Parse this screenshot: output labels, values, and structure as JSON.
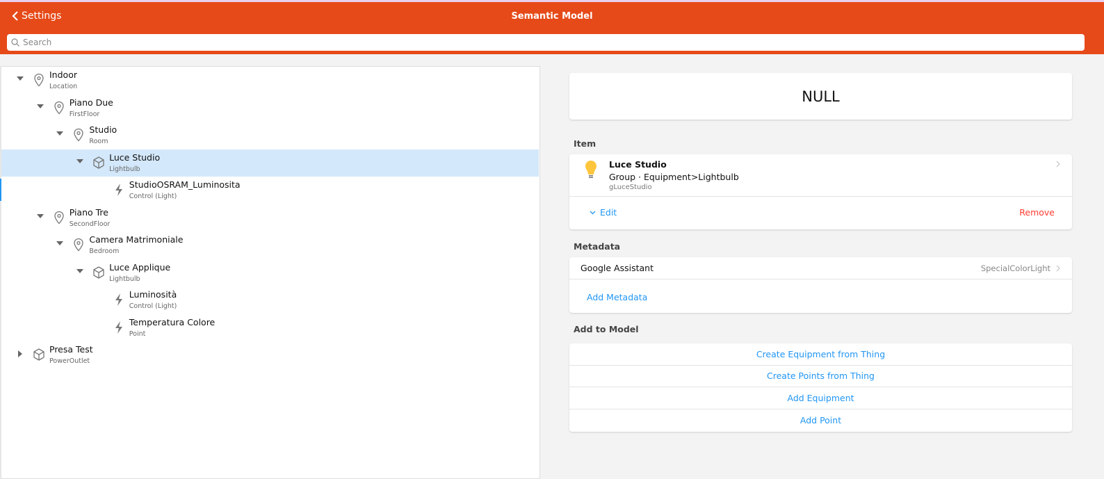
{
  "navbar": {
    "back_label": "Settings",
    "title": "Semantic Model",
    "search_placeholder": "Search"
  },
  "tree": [
    {
      "label": "Indoor",
      "sub": "Location",
      "level": 0,
      "icon": "location",
      "caret": "down"
    },
    {
      "label": "Piano Due",
      "sub": "FirstFloor",
      "level": 1,
      "icon": "location",
      "caret": "down"
    },
    {
      "label": "Studio",
      "sub": "Room",
      "level": 2,
      "icon": "location",
      "caret": "down"
    },
    {
      "label": "Luce Studio",
      "sub": "Lightbulb",
      "level": 3,
      "icon": "cube",
      "caret": "down",
      "selected": true
    },
    {
      "label": "StudioOSRAM_Luminosita",
      "sub": "Control (Light)",
      "level": 4,
      "icon": "bolt",
      "caret": ""
    },
    {
      "label": "Piano Tre",
      "sub": "SecondFloor",
      "level": 1,
      "icon": "location",
      "caret": "down"
    },
    {
      "label": "Camera Matrimoniale",
      "sub": "Bedroom",
      "level": 2,
      "icon": "location",
      "caret": "down"
    },
    {
      "label": "Luce Applique",
      "sub": "Lightbulb",
      "level": 3,
      "icon": "cube",
      "caret": "down"
    },
    {
      "label": "Luminosità",
      "sub": "Control (Light)",
      "level": 4,
      "icon": "bolt",
      "caret": ""
    },
    {
      "label": "Temperatura Colore",
      "sub": "Point",
      "level": 4,
      "icon": "bolt",
      "caret": ""
    },
    {
      "label": "Presa Test",
      "sub": "PowerOutlet",
      "level": 0,
      "icon": "cube",
      "caret": "right"
    }
  ],
  "state": {
    "value": "NULL"
  },
  "item": {
    "section": "Item",
    "name": "Luce Studio",
    "type": "Group · Equipment>Lightbulb",
    "id": "gLuceStudio",
    "edit": "Edit",
    "remove": "Remove"
  },
  "metadata": {
    "section": "Metadata",
    "name": "Google Assistant",
    "value": "SpecialColorLight",
    "add": "Add Metadata"
  },
  "model": {
    "section": "Add to Model",
    "actions": [
      "Create Equipment from Thing",
      "Create Points from Thing",
      "Add Equipment",
      "Add Point"
    ]
  },
  "colors": {
    "brand": "#e64a19",
    "link": "#2196f3",
    "remove": "#ff3b30",
    "selected": "#d3e8fa"
  }
}
